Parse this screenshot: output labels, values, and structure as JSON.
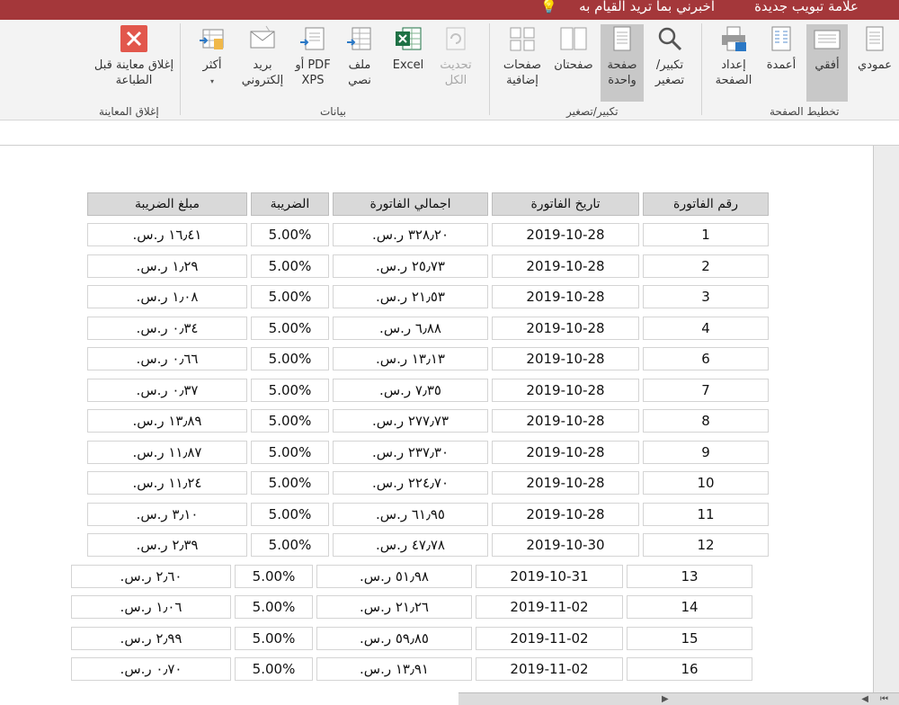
{
  "titlebar": {
    "new_tab_text": "علامة تبويب جديدة",
    "tell_me_text": "أخبرني بما تريد القيام به"
  },
  "ribbon": {
    "buttons": {
      "close_preview": "إغلاق معاينة قبل الطباعة",
      "more": "أكثر",
      "email": "بريد إلكتروني",
      "pdf": "PDF أو XPS",
      "text_file": "ملف نصي",
      "excel": "Excel",
      "refresh_all": "تحديث الكل",
      "more_pages": "صفحات إضافية",
      "two_pages": "صفحتان",
      "one_page": "صفحة واحدة",
      "zoom": "تكبير/ تصغير",
      "page_setup": "إعداد الصفحة",
      "columns": "أعمدة",
      "landscape": "أفقي",
      "portrait": "عمودي"
    },
    "groups": {
      "close_preview": "إغلاق المعاينة",
      "data": "بيانات",
      "zoom": "تكبير/تصغير",
      "page_layout": "تخطيط الصفحة"
    }
  },
  "report": {
    "headers": {
      "invoice_no": "رقم الفاتورة",
      "invoice_date": "تاريخ الفاتورة",
      "invoice_total": "اجمالي الفاتورة",
      "tax": "الضريبة",
      "tax_amount": "مبلغ الضريبة"
    },
    "rows": [
      {
        "no": "1",
        "date": "2019-10-28",
        "total": "٣٢٨٫٢٠ ر.س.",
        "tax": "5.00%",
        "tax_amount": "١٦٫٤١ ر.س."
      },
      {
        "no": "2",
        "date": "2019-10-28",
        "total": "٢٥٫٧٣ ر.س.",
        "tax": "5.00%",
        "tax_amount": "١٫٢٩ ر.س."
      },
      {
        "no": "3",
        "date": "2019-10-28",
        "total": "٢١٫٥٣ ر.س.",
        "tax": "5.00%",
        "tax_amount": "١٫٠٨ ر.س."
      },
      {
        "no": "4",
        "date": "2019-10-28",
        "total": "٦٫٨٨ ر.س.",
        "tax": "5.00%",
        "tax_amount": "٠٫٣٤ ر.س."
      },
      {
        "no": "6",
        "date": "2019-10-28",
        "total": "١٣٫١٣ ر.س.",
        "tax": "5.00%",
        "tax_amount": "٠٫٦٦ ر.س."
      },
      {
        "no": "7",
        "date": "2019-10-28",
        "total": "٧٫٣٥ ر.س.",
        "tax": "5.00%",
        "tax_amount": "٠٫٣٧ ر.س."
      },
      {
        "no": "8",
        "date": "2019-10-28",
        "total": "٢٧٧٫٧٣ ر.س.",
        "tax": "5.00%",
        "tax_amount": "١٣٫٨٩ ر.س."
      },
      {
        "no": "9",
        "date": "2019-10-28",
        "total": "٢٣٧٫٣٠ ر.س.",
        "tax": "5.00%",
        "tax_amount": "١١٫٨٧ ر.س."
      },
      {
        "no": "10",
        "date": "2019-10-28",
        "total": "٢٢٤٫٧٠ ر.س.",
        "tax": "5.00%",
        "tax_amount": "١١٫٢٤ ر.س."
      },
      {
        "no": "11",
        "date": "2019-10-28",
        "total": "٦١٫٩٥ ر.س.",
        "tax": "5.00%",
        "tax_amount": "٣٫١٠ ر.س."
      },
      {
        "no": "12",
        "date": "2019-10-30",
        "total": "٤٧٫٧٨ ر.س.",
        "tax": "5.00%",
        "tax_amount": "٢٫٣٩ ر.س."
      },
      {
        "no": "13",
        "date": "2019-10-31",
        "total": "٥١٫٩٨ ر.س.",
        "tax": "5.00%",
        "tax_amount": "٢٫٦٠ ر.س."
      },
      {
        "no": "14",
        "date": "2019-11-02",
        "total": "٢١٫٢٦ ر.س.",
        "tax": "5.00%",
        "tax_amount": "١٫٠٦ ر.س."
      },
      {
        "no": "15",
        "date": "2019-11-02",
        "total": "٥٩٫٨٥ ر.س.",
        "tax": "5.00%",
        "tax_amount": "٢٫٩٩ ر.س."
      },
      {
        "no": "16",
        "date": "2019-11-02",
        "total": "١٣٫٩١ ر.س.",
        "tax": "5.00%",
        "tax_amount": "٠٫٧٠ ر.س."
      }
    ]
  },
  "icons": {
    "close_preview": "close-x-icon",
    "more": "more-export-icon",
    "email": "email-icon",
    "pdf": "pdf-export-icon",
    "text_file": "text-file-icon",
    "excel": "excel-icon",
    "refresh_all": "refresh-icon",
    "more_pages": "multiple-pages-icon",
    "two_pages": "two-pages-icon",
    "one_page": "one-page-icon",
    "zoom": "magnifier-icon",
    "page_setup": "printer-icon",
    "columns": "columns-icon",
    "landscape": "landscape-icon",
    "portrait": "portrait-icon"
  },
  "colors": {
    "titlebar": "#a4373a",
    "close_button": "#e2574c",
    "excel": "#1e7145",
    "header_cell": "#d9d9d9"
  }
}
